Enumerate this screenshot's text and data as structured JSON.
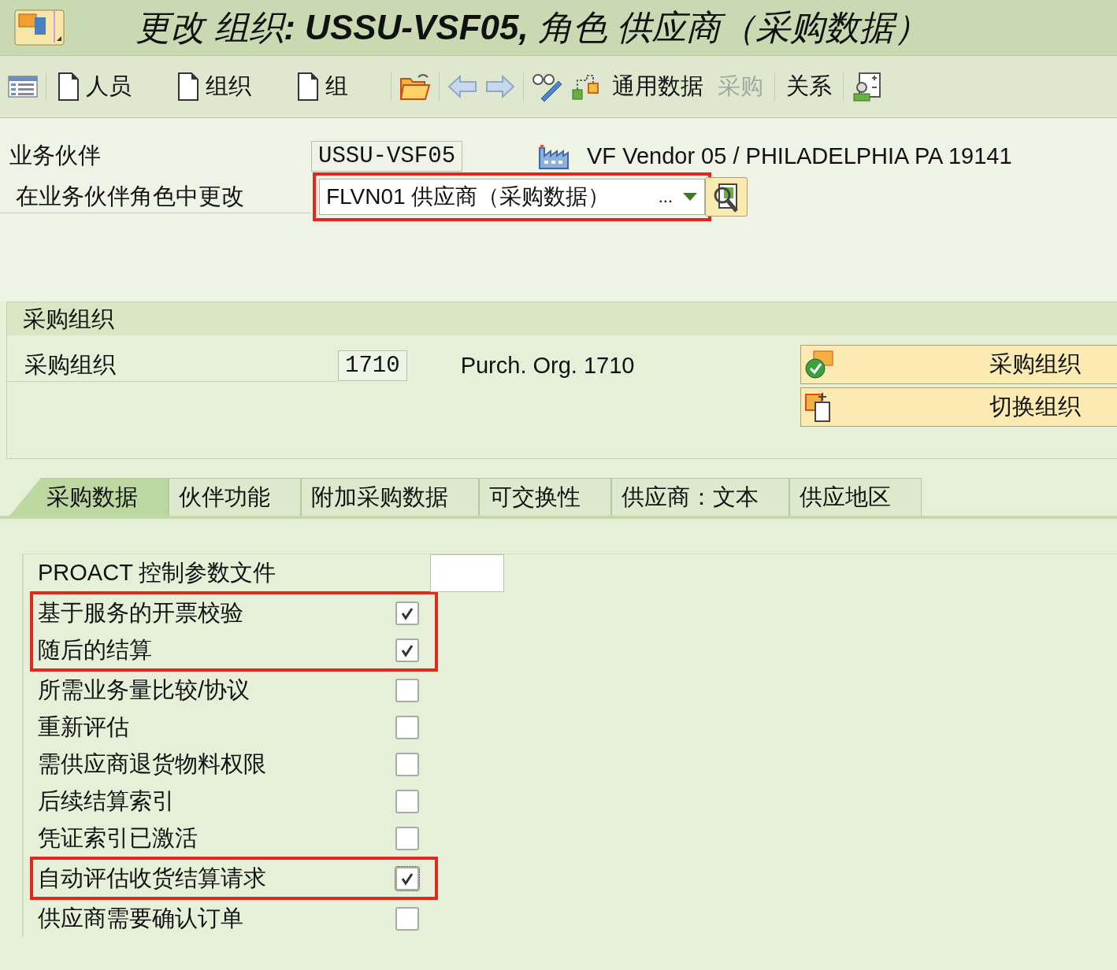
{
  "window": {
    "title": "更改 组织**: USSU-VSF05,** 角色 供应商（采购数据）"
  },
  "toolbar": [
    {
      "kind": "listview"
    },
    {
      "kind": "sep"
    },
    {
      "kind": "doc",
      "label": "人员"
    },
    {
      "kind": "doc",
      "label": "组织"
    },
    {
      "kind": "doc",
      "label": "组"
    },
    {
      "kind": "sep"
    },
    {
      "kind": "folder"
    },
    {
      "kind": "sep"
    },
    {
      "kind": "back"
    },
    {
      "kind": "forward"
    },
    {
      "kind": "sep"
    },
    {
      "kind": "glasses"
    },
    {
      "kind": "hierarchy"
    },
    {
      "kind": "text",
      "label": "通用数据",
      "disabled": false
    },
    {
      "kind": "text",
      "label": "采购",
      "disabled": true
    },
    {
      "kind": "sep"
    },
    {
      "kind": "text",
      "label": "关系",
      "disabled": false
    },
    {
      "kind": "sep"
    },
    {
      "kind": "person"
    }
  ],
  "partner": {
    "label": "业务伙伴",
    "value": "USSU-VSF05",
    "description": "VF Vendor 05 / PHILADELPHIA PA 19141"
  },
  "role": {
    "label": "在业务伙伴角色中更改",
    "value": "FLVN01 供应商（采购数据）",
    "ellipsis": "...",
    "highlighted": true
  },
  "purch_org_group": {
    "title": "采购组织",
    "label": "采购组织",
    "value": "1710",
    "description": "Purch. Org. 1710",
    "buttons": [
      {
        "label": "采购组织"
      },
      {
        "label": "切换组织"
      }
    ]
  },
  "tabs": [
    {
      "label": "采购数据",
      "selected": true
    },
    {
      "label": "伙伴功能",
      "selected": false
    },
    {
      "label": "附加采购数据",
      "selected": false
    },
    {
      "label": "可交换性",
      "selected": false
    },
    {
      "label": "供应商：文本",
      "selected": false
    },
    {
      "label": "供应地区",
      "selected": false
    }
  ],
  "fields": [
    {
      "kind": "input",
      "label": "PROACT 控制参数文件",
      "highlighted": false
    },
    {
      "kind": "checkbox",
      "label": "基于服务的开票校验",
      "checked": true,
      "highlighted": true
    },
    {
      "kind": "checkbox",
      "label": "随后的结算",
      "checked": true,
      "highlighted": true
    },
    {
      "kind": "checkbox",
      "label": "所需业务量比较/协议",
      "checked": false,
      "highlighted": false
    },
    {
      "kind": "checkbox",
      "label": "重新评估",
      "checked": false,
      "highlighted": false
    },
    {
      "kind": "checkbox",
      "label": "需供应商退货物料权限",
      "checked": false,
      "highlighted": false
    },
    {
      "kind": "checkbox",
      "label": "后续结算索引",
      "checked": false,
      "highlighted": false
    },
    {
      "kind": "checkbox",
      "label": "凭证索引已激活",
      "checked": false,
      "highlighted": false
    },
    {
      "kind": "checkbox",
      "label": "自动评估收货结算请求",
      "checked": true,
      "highlighted": true
    },
    {
      "kind": "checkbox",
      "label": "供应商需要确认订单",
      "checked": false,
      "highlighted": false
    }
  ]
}
